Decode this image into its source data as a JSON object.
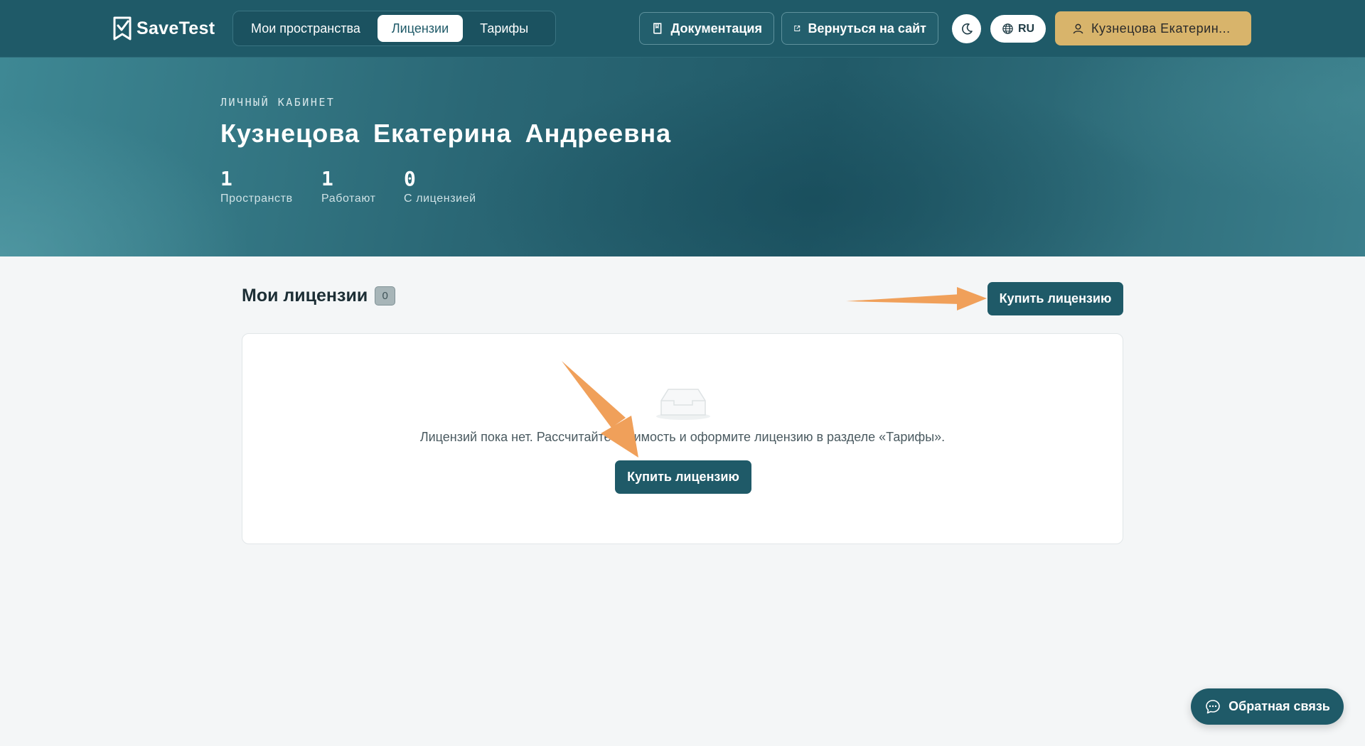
{
  "brand": {
    "name": "SaveTest",
    "icon": "savetest-logo-icon"
  },
  "nav": {
    "tabs": [
      {
        "label": "Мои пространства",
        "active": false
      },
      {
        "label": "Лицензии",
        "active": true
      },
      {
        "label": "Тарифы",
        "active": false
      }
    ]
  },
  "header": {
    "docs_label": "Документация",
    "docs_icon": "book-icon",
    "back_label": "Вернуться на сайт",
    "back_icon": "external-link-icon",
    "theme_icon": "moon-icon",
    "lang_label": "RU",
    "lang_icon": "globe-icon",
    "user_label": "Кузнецова Екатерин...",
    "user_icon": "user-icon"
  },
  "hero": {
    "kicker": "ЛИЧНЫЙ КАБИНЕТ",
    "name": "Кузнецова Екатерина Андреевна",
    "stats": [
      {
        "value": "1",
        "label": "Пространств"
      },
      {
        "value": "1",
        "label": "Работают"
      },
      {
        "value": "0",
        "label": "С лицензией"
      }
    ]
  },
  "licenses": {
    "title": "Мои лицензии",
    "count": "0",
    "buy_label": "Купить лицензию",
    "empty_icon": "inbox-icon",
    "empty_text": "Лицензий пока нет. Рассчитайте стоимость и оформите лицензию в разделе «Тарифы».",
    "empty_buy_label": "Купить лицензию"
  },
  "feedback": {
    "label": "Обратная связь",
    "icon": "chat-icon"
  },
  "colors": {
    "primary": "#1f5a68",
    "accent_gold": "#d8b46b",
    "arrow": "#f0a05a",
    "background": "#f4f6f7"
  }
}
